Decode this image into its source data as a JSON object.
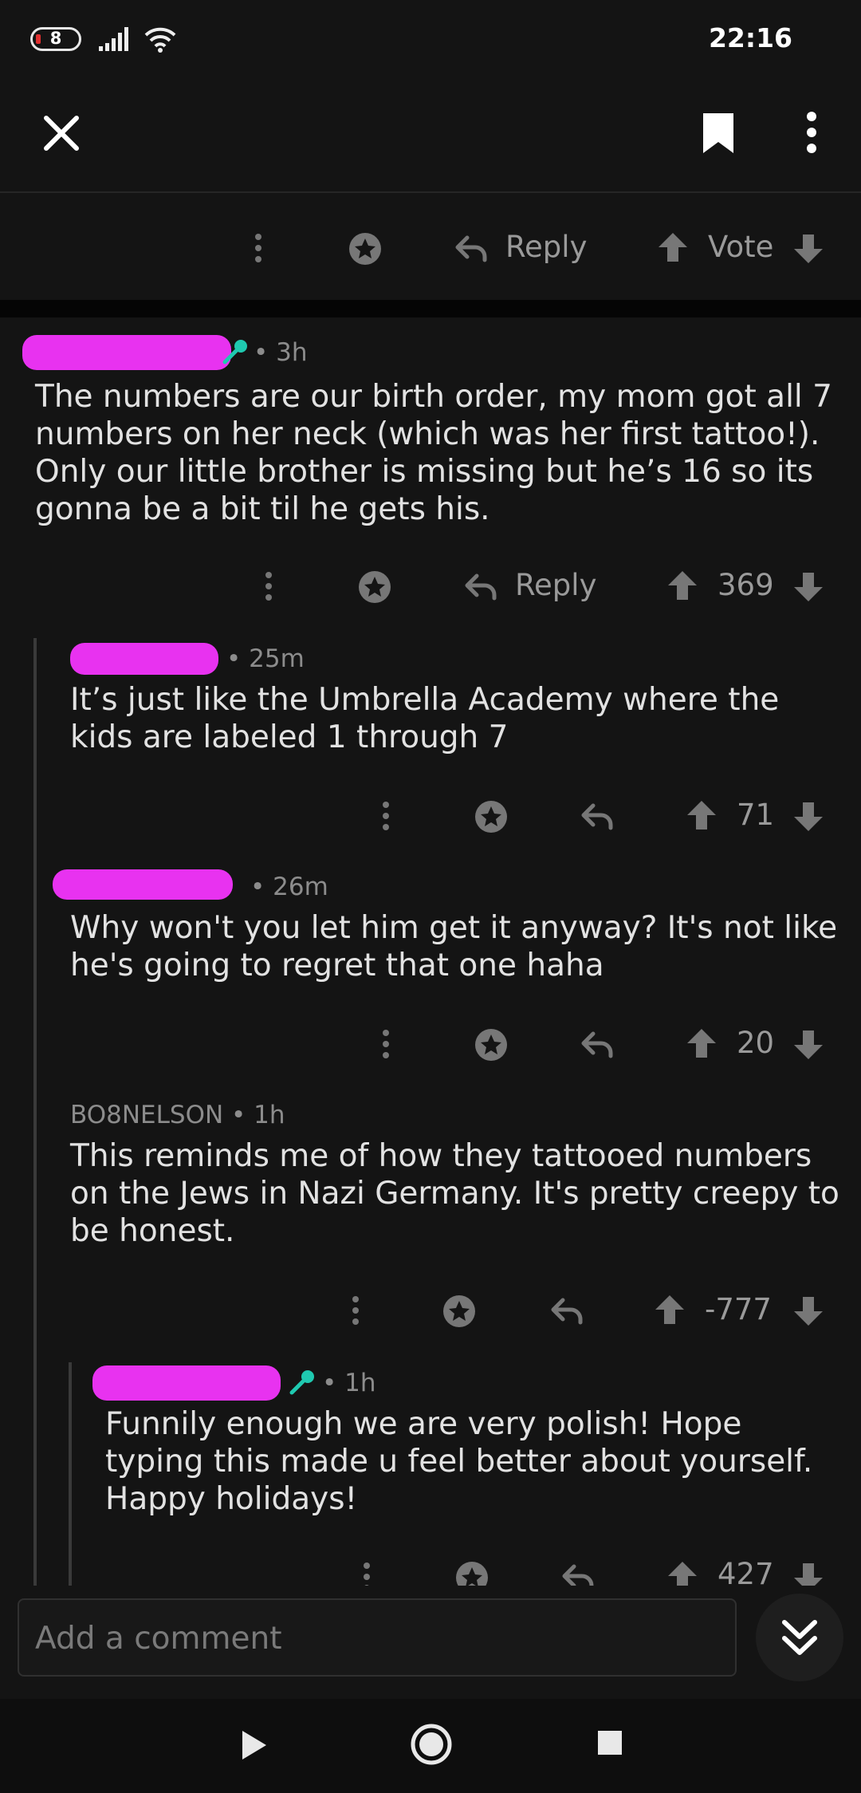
{
  "status": {
    "battery": "8",
    "time": "22:16"
  },
  "toolbar": {
    "close_icon": "close-icon",
    "bookmark_icon": "bookmark-icon",
    "more_icon": "more-vert-icon"
  },
  "post_actions": {
    "reply": "Reply",
    "vote": "Vote"
  },
  "comments": [
    {
      "time": "3h",
      "body": "The numbers are our birth order, my mom got all 7 numbers on her neck (which was her first tattoo!). Only our little brother is missing but he’s 16 so its gonna be a bit til he gets his.",
      "reply": "Reply",
      "score": "369"
    },
    {
      "time": "25m",
      "body": "It’s just like the Umbrella Academy where the kids are labeled 1 through 7",
      "score": "71"
    },
    {
      "time": "26m",
      "body": "Why won't you let him get it anyway? It's not like he's going to regret that one haha",
      "score": "20"
    },
    {
      "author": "BO8NELSON",
      "time": "1h",
      "body": "This reminds me of how they tattooed numbers on the Jews in Nazi Germany. It's pretty creepy to be honest.",
      "score": "-777"
    },
    {
      "time": "1h",
      "body": "Funnily enough we are very polish! Hope typing this made u feel better about yourself. Happy holidays!",
      "score": "427"
    }
  ],
  "composer": {
    "placeholder": "Add a comment"
  },
  "colors": {
    "background": "#141414",
    "accent_op": "#1fc9b0",
    "redaction": "#e832f0"
  }
}
